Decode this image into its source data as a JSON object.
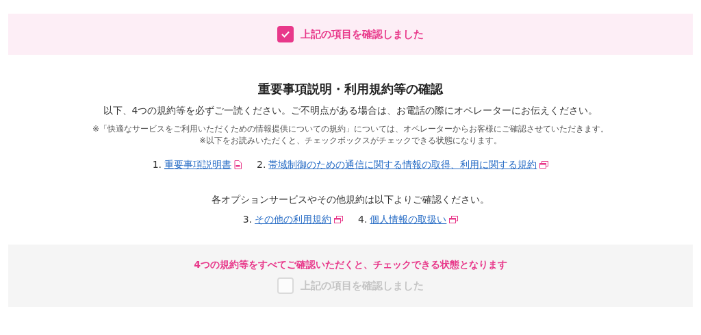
{
  "top_confirm": {
    "label": "上記の項目を確認しました",
    "checked": true,
    "disabled": false
  },
  "title": "重要事項説明・利用規約等の確認",
  "lead": "以下、4つの規約等を必ずご一読ください。ご不明点がある場合は、お電話の際にオペレーターにお伝えください。",
  "notes": [
    "※「快適なサービスをご利用いただくための情報提供についての規約」については、オペレーターからお客様にご確認させていただきます。",
    "※以下をお読みいただくと、チェックボックスがチェックできる状態になります。"
  ],
  "links_primary": [
    {
      "number": "1.",
      "label": "重要事項説明書",
      "kind": "pdf"
    },
    {
      "number": "2.",
      "label": "帯域制御のための通信に関する情報の取得、利用に関する規約",
      "kind": "window"
    }
  ],
  "options_text": "各オプションサービスやその他規約は以下よりご確認ください。",
  "links_secondary": [
    {
      "number": "3.",
      "label": "その他の利用規約",
      "kind": "window"
    },
    {
      "number": "4.",
      "label": "個人情報の取扱い",
      "kind": "window"
    }
  ],
  "bottom_notice": "4つの規約等をすべてご確認いただくと、チェックできる状態となります",
  "bottom_confirm": {
    "label": "上記の項目を確認しました",
    "checked": false,
    "disabled": true
  }
}
